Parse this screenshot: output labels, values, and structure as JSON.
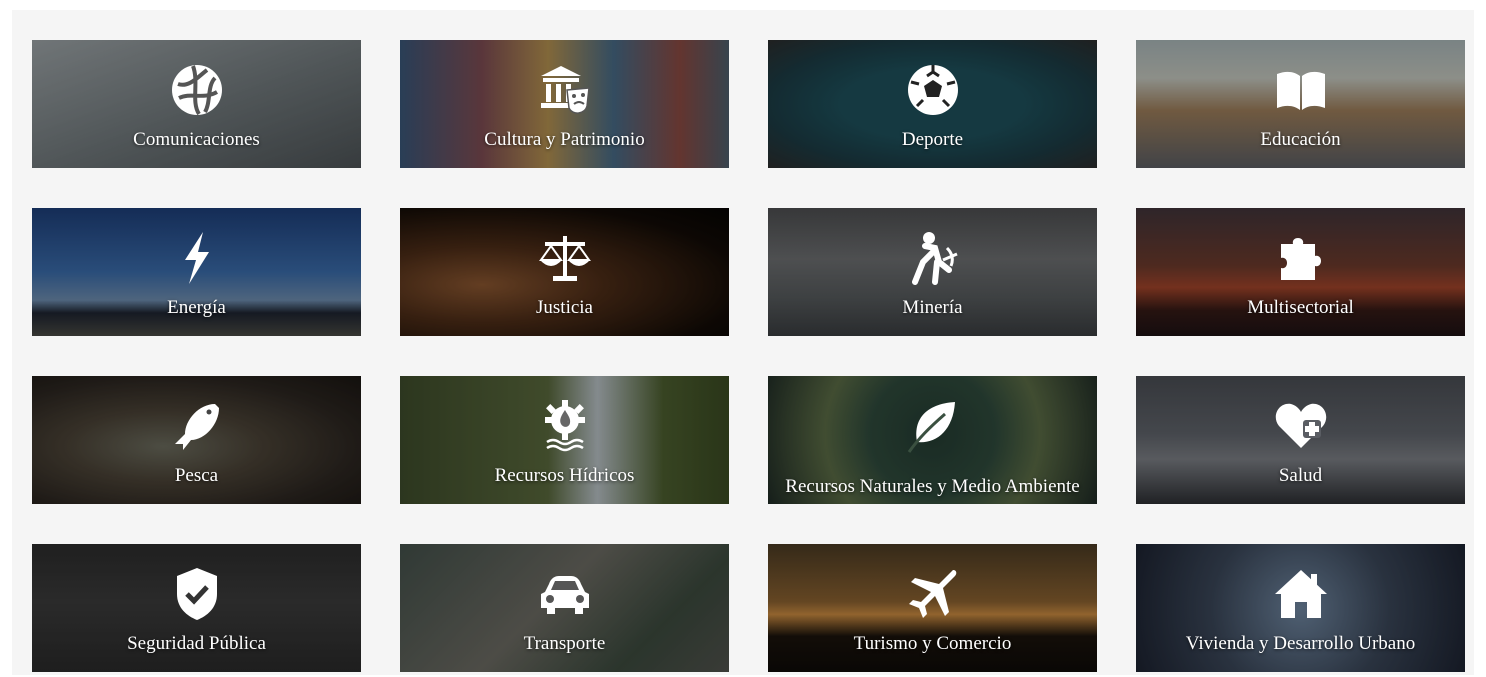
{
  "categories": [
    {
      "label": "Comunicaciones",
      "icon": "globe-network-icon"
    },
    {
      "label": "Cultura y Patrimonio",
      "icon": "museum-theater-icon"
    },
    {
      "label": "Deporte",
      "icon": "soccer-ball-icon"
    },
    {
      "label": "Educación",
      "icon": "open-book-icon"
    },
    {
      "label": "Energía",
      "icon": "lightning-bolt-icon"
    },
    {
      "label": "Justicia",
      "icon": "balance-scale-icon"
    },
    {
      "label": "Minería",
      "icon": "miner-pickaxe-icon"
    },
    {
      "label": "Multisectorial",
      "icon": "puzzle-piece-icon"
    },
    {
      "label": "Pesca",
      "icon": "fish-icon"
    },
    {
      "label": "Recursos Hídricos",
      "icon": "water-drop-gear-icon"
    },
    {
      "label": "Recursos Naturales y Medio Ambiente",
      "icon": "leaf-icon"
    },
    {
      "label": "Salud",
      "icon": "heart-plus-icon"
    },
    {
      "label": "Seguridad Pública",
      "icon": "shield-check-icon"
    },
    {
      "label": "Transporte",
      "icon": "car-icon"
    },
    {
      "label": "Turismo y Comercio",
      "icon": "airplane-icon"
    },
    {
      "label": "Vivienda y Desarrollo Urbano",
      "icon": "house-icon"
    }
  ],
  "colors": {
    "page_background": "#f5f5f5",
    "label_text": "#ffffff",
    "icon_fill": "#ffffff"
  }
}
